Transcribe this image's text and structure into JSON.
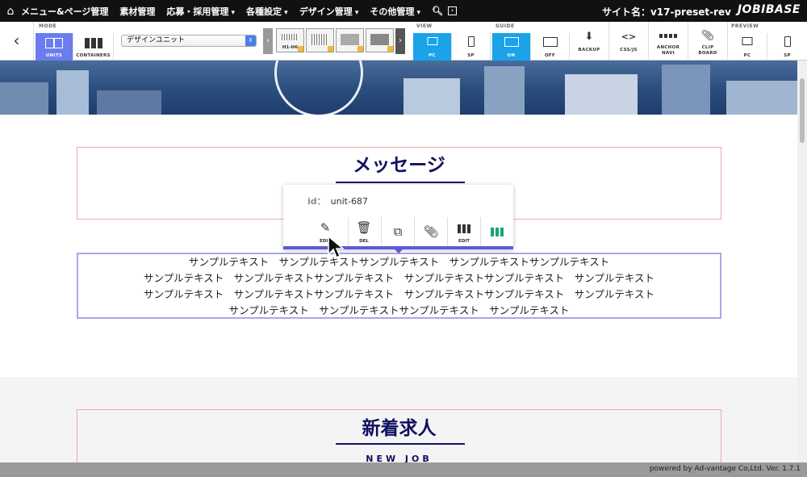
{
  "topnav": {
    "home_icon": "home-icon",
    "menu": [
      {
        "label": "メニュー&ページ管理",
        "dropdown": false
      },
      {
        "label": "素材管理",
        "dropdown": false
      },
      {
        "label": "応募・採用管理",
        "dropdown": true
      },
      {
        "label": "各種設定",
        "dropdown": true
      },
      {
        "label": "デザイン管理",
        "dropdown": true
      },
      {
        "label": "その他管理",
        "dropdown": true
      }
    ],
    "site_name": "サイト名：v17-preset-rev",
    "logo": "JOBIBASE"
  },
  "toolbar": {
    "mode_label": "MODE",
    "units_label": "UNITS",
    "containers_label": "CONTAINERS",
    "select_value": "デザインユニット",
    "thumbs": [
      "H1-H6",
      "",
      "",
      ""
    ],
    "view_label": "VIEW",
    "view_pc": "PC",
    "view_sp": "SP",
    "guide_label": "GUIDE",
    "guide_on": "ON",
    "guide_off": "OFF",
    "backup": "BACKUP",
    "cssjs": "CSS/JS",
    "anchor1": "ANCHOR",
    "anchor2": "NAVI",
    "clip1": "CLIP",
    "clip2": "BOARD",
    "preview_label": "PREVIEW",
    "preview_pc": "PC",
    "preview_sp": "SP"
  },
  "content": {
    "heading1": "メッセージ",
    "text_rows": [
      "サンプルテキスト　サンプルテキストサンプルテキスト　サンプルテキストサンプルテキスト",
      "サンプルテキスト　サンプルテキストサンプルテキスト　サンプルテキストサンプルテキスト　サンプルテキスト",
      "サンプルテキスト　サンプルテキストサンプルテキスト　サンプルテキストサンプルテキスト　サンプルテキスト",
      "サンプルテキスト　サンプルテキストサンプルテキスト　サンプルテキスト"
    ],
    "heading2": "新着求人",
    "sublabel2": "NEW JOB"
  },
  "popup": {
    "id_label": "id：",
    "id_value": "unit-687",
    "edit": "EDIT",
    "del": "DEL",
    "edit2": "EDIT"
  },
  "footer": {
    "text": "powered by Ad-vantage Co,Ltd. Ver. 1.7.1"
  },
  "colors": {
    "accent": "#6b7cf0",
    "blue": "#1aa3e8",
    "heading": "#101060",
    "green": "#1aa37a"
  }
}
